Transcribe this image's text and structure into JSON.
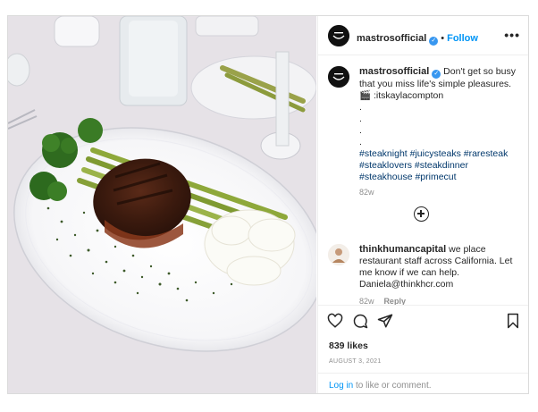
{
  "post": {
    "username": "mastrosofficial",
    "follow_label": "Follow",
    "dot": "•",
    "more_label": "•••"
  },
  "caption": {
    "username": "mastrosofficial",
    "text": "Don't get so busy that you miss life's simple pleasures.",
    "credit_icon": "🎬",
    "credit": ":itskaylacompton",
    "dots": [
      ".",
      ".",
      ".",
      "."
    ],
    "hashtags": [
      "#steaknight #juicysteaks #raresteak",
      "#steaklovers #steakdinner",
      "#steakhouse #primecut"
    ],
    "age": "82w"
  },
  "comment": {
    "username": "thinkhumancapital",
    "text": "we place restaurant staff across California. Let me know if we can help. Daniela@thinkhcr.com",
    "age": "82w",
    "reply_label": "Reply"
  },
  "actions": {
    "likes": "839 likes",
    "date": "AUGUST 3, 2021"
  },
  "login": {
    "link": "Log in",
    "rest": "to like or comment."
  },
  "colors": {
    "accent": "#0095f6",
    "hashtag": "#00376b",
    "muted": "#8e8e8e",
    "verified": "#3897f0"
  }
}
